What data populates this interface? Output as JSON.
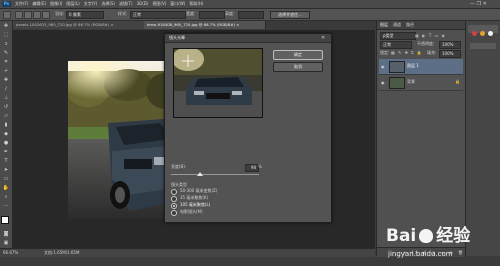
{
  "menubar": {
    "logo": "Ps",
    "items": [
      "文件(F)",
      "编辑(E)",
      "图像(I)",
      "图层(L)",
      "文字(Y)",
      "选择(S)",
      "滤镜(T)",
      "3D(D)",
      "视图(V)",
      "窗口(W)",
      "帮助(H)"
    ]
  },
  "options": {
    "feather_label": "羽化:",
    "feather_value": "0 像素",
    "style_label": "样式:",
    "style_value": "正常",
    "width_label": "宽度:",
    "height_label": "高度:",
    "select_mask_button": "选择并遮住..."
  },
  "tabs": [
    {
      "label": "pexels-1042633_960_720.jpg @ 66.7% (RGB/8#) ×",
      "active": false
    },
    {
      "label": "bmw-918408_960_720.jpg @ 66.7% (RGB/8#) ×",
      "active": true
    }
  ],
  "status": {
    "zoom": "66.67%",
    "doc": "文档:1.65M/1.65M"
  },
  "panel": {
    "tabs": [
      "图层",
      "通道",
      "路径"
    ],
    "kind_label": "ρ类型",
    "blend_mode": "正常",
    "opacity_label": "不透明度:",
    "opacity_value": "100%",
    "lock_label": "锁定:",
    "fill_label": "填充:",
    "fill_value": "100%",
    "layers": [
      {
        "name": "图层 1",
        "selected": true
      },
      {
        "name": "背景",
        "selected": false
      }
    ]
  },
  "dialog": {
    "title": "镜头光晕",
    "ok_button": "确定",
    "cancel_button": "取消",
    "brightness_label": "亮度(B):",
    "brightness_value": "98",
    "brightness_unit": "%",
    "lens_type_label": "镜头类型",
    "lens_options": [
      {
        "label": "50-300 毫米变焦(Z)",
        "checked": false
      },
      {
        "label": "35 毫米聚焦(K)",
        "checked": false
      },
      {
        "label": "105 毫米聚焦(L)",
        "checked": true
      },
      {
        "label": "电影镜头(M)",
        "checked": false
      }
    ]
  },
  "watermark": {
    "brand_left": "Bai",
    "brand_right": "经验",
    "url": "jingyan.baidu.com"
  }
}
